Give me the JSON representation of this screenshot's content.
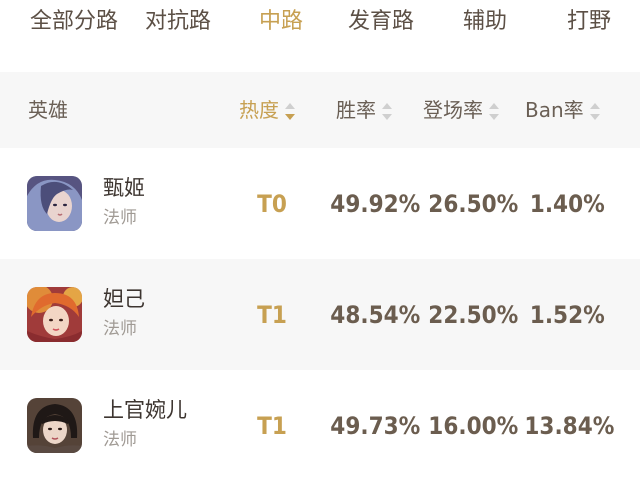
{
  "tabs": [
    {
      "label": "全部分路",
      "active": false
    },
    {
      "label": "对抗路",
      "active": false
    },
    {
      "label": "中路",
      "active": true
    },
    {
      "label": "发育路",
      "active": false
    },
    {
      "label": "辅助",
      "active": false
    },
    {
      "label": "打野",
      "active": false
    }
  ],
  "header": {
    "hero": "英雄",
    "heat": "热度",
    "win": "胜率",
    "pick": "登场率",
    "ban": "Ban率",
    "active_sort": "heat",
    "sort_direction": "desc"
  },
  "rows": [
    {
      "name": "甄姬",
      "role": "法师",
      "tier": "T0",
      "win": "49.92%",
      "pick": "26.50%",
      "ban": "1.40%",
      "avatar_icon": "zhenji-avatar"
    },
    {
      "name": "妲己",
      "role": "法师",
      "tier": "T1",
      "win": "48.54%",
      "pick": "22.50%",
      "ban": "1.52%",
      "avatar_icon": "daji-avatar"
    },
    {
      "name": "上官婉儿",
      "role": "法师",
      "tier": "T1",
      "win": "49.73%",
      "pick": "16.00%",
      "ban": "13.84%",
      "avatar_icon": "shangguan-avatar"
    }
  ],
  "colors": {
    "accent": "#c7a052",
    "text": "#5c5046",
    "muted": "#a09a94",
    "row_alt": "#f7f7f7"
  }
}
